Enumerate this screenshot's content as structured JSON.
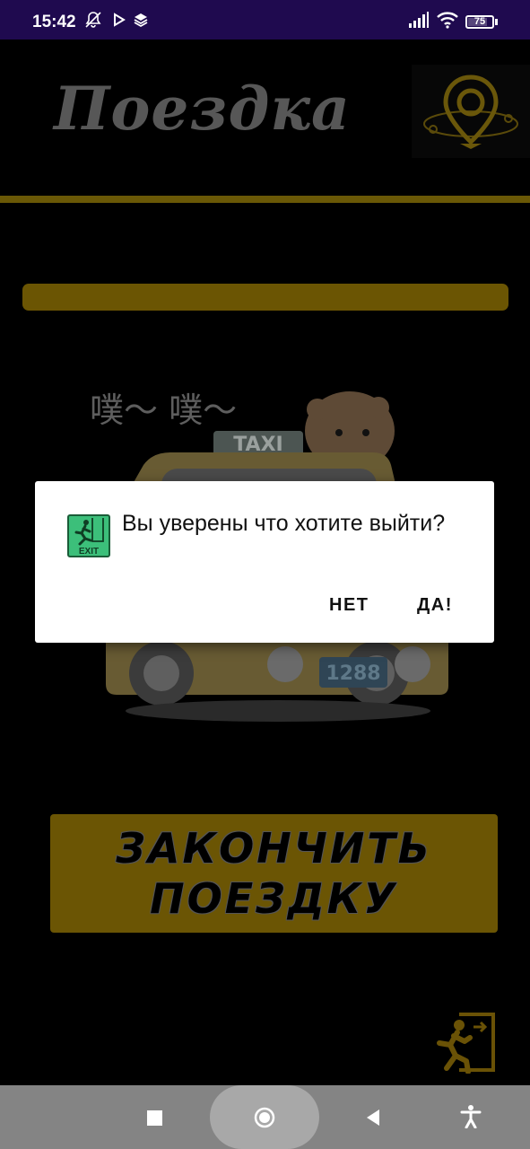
{
  "status_bar": {
    "time": "15:42",
    "battery_level": "75",
    "icons": [
      "bell-off-icon",
      "play-icon",
      "layers-icon",
      "signal-icon",
      "wifi-icon",
      "battery-icon"
    ]
  },
  "app": {
    "title": "Поездка",
    "progress_fraction": 1.0,
    "finish_button_label": "ЗАКОНЧИТЬ\nПОЕЗДКУ",
    "illustration": {
      "taxi_sign": "TAXI",
      "plate": "1288",
      "sound_text": "噗～ 噗～"
    }
  },
  "dialog": {
    "icon_label": "EXIT",
    "message": "Вы уверены что хотите выйти?",
    "negative_button": "НЕТ",
    "positive_button": "ДА!"
  },
  "colors": {
    "status_bar": "#1f0a4f",
    "accent_gold": "#6b5504",
    "dialog_bg": "#ffffff",
    "nav_bar": "#848484"
  }
}
